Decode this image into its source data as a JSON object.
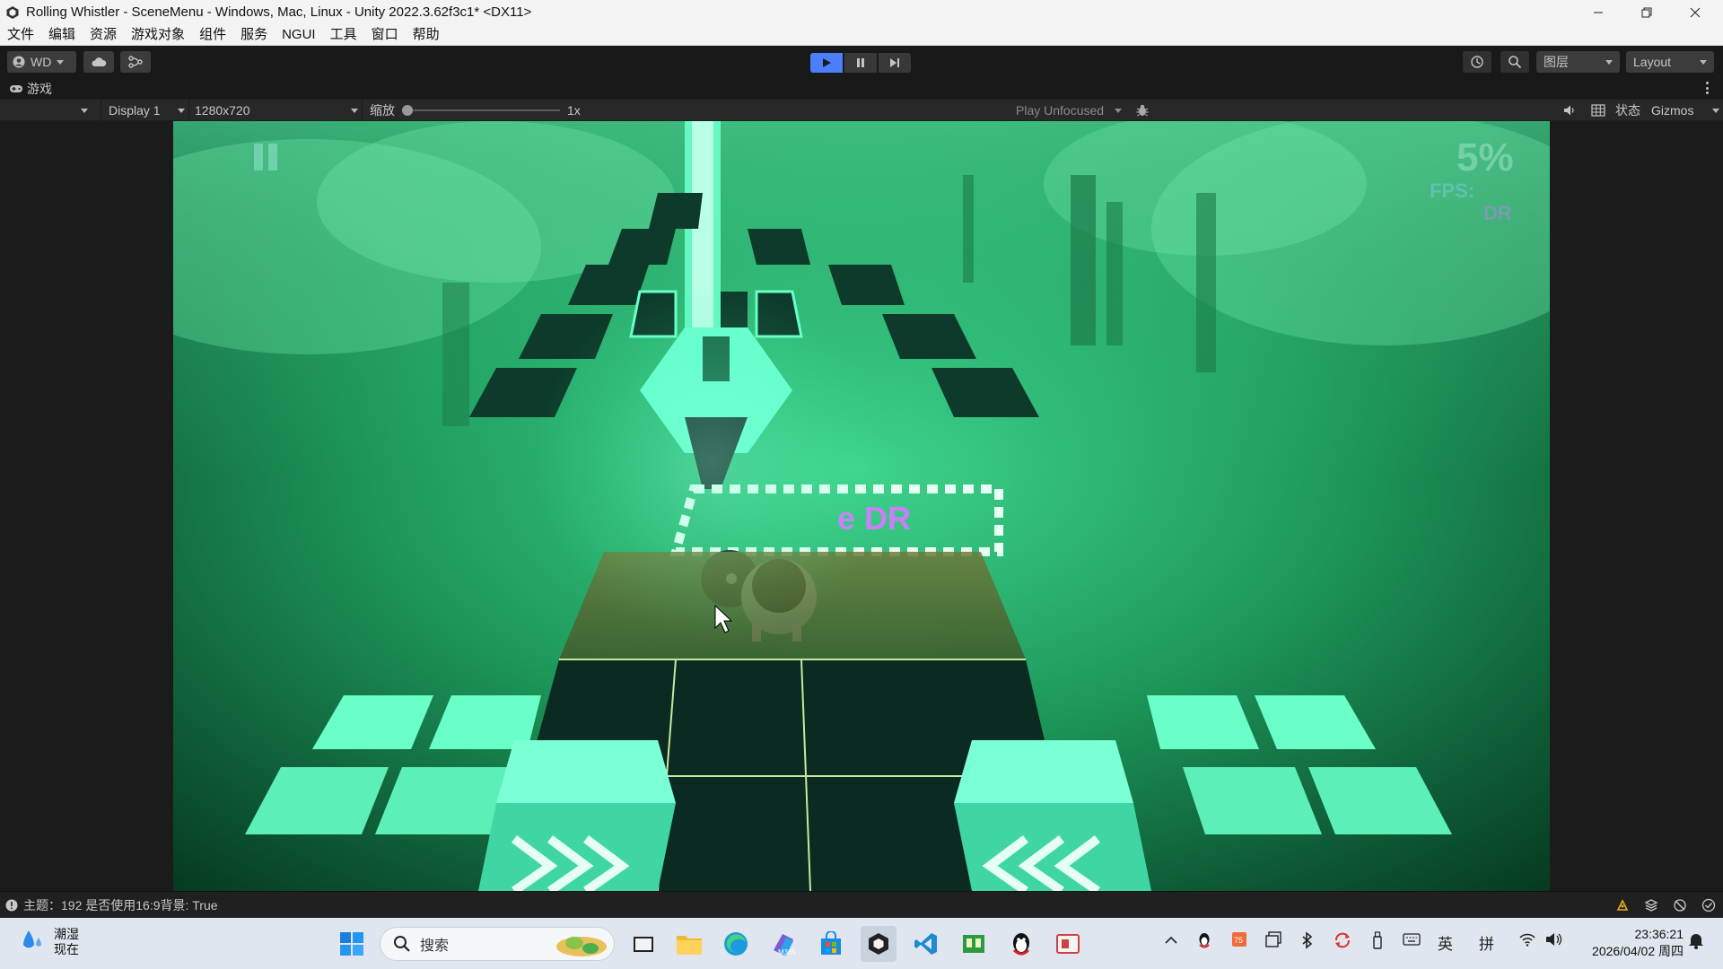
{
  "window": {
    "title": "Rolling Whistler - SceneMenu - Windows, Mac, Linux - Unity 2022.3.62f3c1* <DX11>"
  },
  "menu": [
    "文件",
    "编辑",
    "资源",
    "游戏对象",
    "组件",
    "服务",
    "NGUI",
    "工具",
    "窗口",
    "帮助"
  ],
  "toolbar": {
    "account": "WD",
    "layers": "图层",
    "layout": "Layout"
  },
  "tab": {
    "label": "游戏"
  },
  "gamebar": {
    "display": "Display 1",
    "resolution": "1280x720",
    "scale_label": "缩放",
    "scale_value": "1x",
    "scale_fraction": 0.0,
    "play_mode": "Play Unfocused",
    "stats": "状态",
    "gizmos": "Gizmos"
  },
  "game": {
    "hud_percent": "5%",
    "hud_fps": "FPS:",
    "hud_word": "DR",
    "sign_text": "e DR"
  },
  "status": {
    "message": "主题：192 是否使用16:9背景: True"
  },
  "taskbar": {
    "weather_title": "潮湿",
    "weather_sub": "现在",
    "search_placeholder": "搜索",
    "ime_lang": "英",
    "ime_mode": "拼",
    "time": "23:36:21",
    "date": "2026/04/02 周四"
  },
  "colors": {
    "accent_play": "#4c7fff",
    "neon_green": "#3dffb0",
    "panel": "#282828"
  }
}
